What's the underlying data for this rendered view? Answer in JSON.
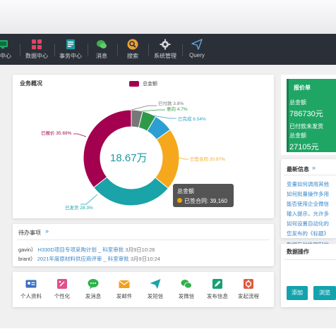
{
  "nav": {
    "items": [
      {
        "label": "息中心",
        "icon": "monitor-icon",
        "color": "#1fa665"
      },
      {
        "label": "数据中心",
        "icon": "grid-icon",
        "color": "#e04463"
      },
      {
        "label": "事务中心",
        "icon": "notebook-icon",
        "color": "#1c9aa3"
      },
      {
        "label": "消息",
        "icon": "chat-icon",
        "color": "#3cb44a"
      },
      {
        "label": "搜索",
        "icon": "search-icon",
        "color": "#e8a23a"
      },
      {
        "label": "系统管理",
        "icon": "gear-icon",
        "color": "#d0d3d8"
      },
      {
        "label": "Query",
        "icon": "paper-plane-icon",
        "color": "#6aa8e0"
      }
    ]
  },
  "overview": {
    "title": "业务概况",
    "legend": "总金额",
    "center_value": "18.67万"
  },
  "chart_data": {
    "type": "pie",
    "title": "业务概况",
    "legend": [
      "总金额"
    ],
    "center_label": "18.67万",
    "slices": [
      {
        "name": "已签合同",
        "value": 20.97,
        "label": "已签合同 20.97%",
        "color": "#f5a81c"
      },
      {
        "name": "已发货",
        "value": 28.3,
        "label": "已发货 28.3%",
        "color": "#1aa3a8"
      },
      {
        "name": "已报价",
        "value": 35.69,
        "label": "已报价 35.69%",
        "color": "#a3004f"
      },
      {
        "name": "已付款",
        "value": 3.8,
        "label": "已付款 3.8%",
        "color": "#777777"
      },
      {
        "name": "意向",
        "value": 4.7,
        "label": "意向 4.7%",
        "color": "#2e9a48"
      },
      {
        "name": "已完成",
        "value": 6.54,
        "label": "已完成 6.54%",
        "color": "#2c9ed2"
      }
    ],
    "tooltip": {
      "title": "总金额",
      "text": "已签合同: 39,160"
    }
  },
  "todo": {
    "title": "待办事项",
    "rows": [
      {
        "user": "gavin）",
        "item": "H330D项目专项采购计划 _ 科室审批",
        "date": "3月9日10:26"
      },
      {
        "user": "brant）",
        "item": "2021年度原材料供应商评审 _ 科室审批",
        "date": "3月9日10:24"
      }
    ]
  },
  "quick_actions": [
    {
      "label": "个人资料",
      "icon": "id-card-icon",
      "color": "#3b6fc4"
    },
    {
      "label": "个性化",
      "icon": "palette-icon",
      "color": "#e0508a"
    },
    {
      "label": "发消息",
      "icon": "chat-bubble-icon",
      "color": "#2fb24a"
    },
    {
      "label": "发邮件",
      "icon": "envelope-icon",
      "color": "#f0a020"
    },
    {
      "label": "发短信",
      "icon": "paper-plane-icon",
      "color": "#1aa3a8"
    },
    {
      "label": "发微信",
      "icon": "wechat-icon",
      "color": "#2fb24a"
    },
    {
      "label": "发布信息",
      "icon": "edit-icon",
      "color": "#18a070"
    },
    {
      "label": "发起流程",
      "icon": "workflow-icon",
      "color": "#e05a40"
    }
  ],
  "quote": {
    "title": "报价单",
    "total_label": "总金额",
    "total_value": "786730元",
    "unpaid_label": "已付款未发货",
    "amount_label": "总金额",
    "amount_value": "27105元"
  },
  "news": {
    "title": "最新信息",
    "items": [
      "变量如何调用其他",
      "如何批量操作多用",
      "能否使用企业微信",
      "输入提示，允许多",
      "如何设置自动化的",
      "您发布的《标题》",
      "数据有效性限制的"
    ]
  },
  "data_ops": {
    "title": "数据操作",
    "add_label": "添加",
    "browse_label": "浏览"
  }
}
